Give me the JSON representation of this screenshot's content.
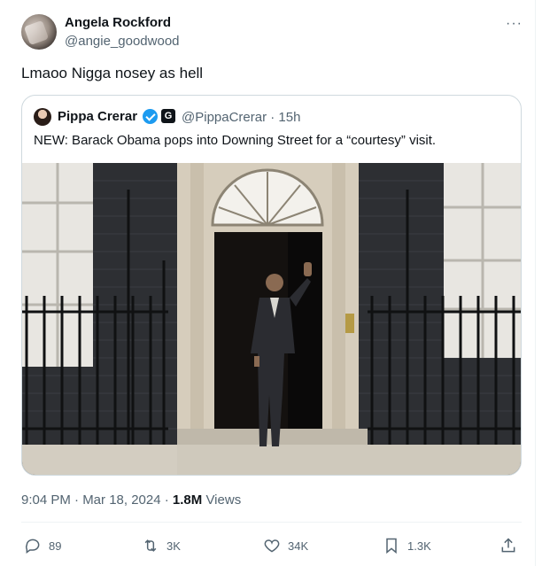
{
  "post": {
    "author_name": "Angela Rockford",
    "author_handle": "@angie_goodwood",
    "more_label": "···",
    "text": "Lmaoo Nigga nosey as hell"
  },
  "quote": {
    "author_name": "Pippa Crerar",
    "author_handle": "@PippaCrerar · 15h",
    "org_badge": "G",
    "text": "NEW: Barack Obama pops into Downing Street for a “courtesy” visit."
  },
  "meta": {
    "time_date": "9:04 PM · Mar 18, 2024 · ",
    "views_count": "1.8M",
    "views_label": " Views"
  },
  "actions": {
    "replies": "89",
    "reposts": "3K",
    "likes": "34K",
    "bookmarks": "1.3K"
  },
  "icons": {
    "more": "more-icon",
    "verified": "verified-icon",
    "reply": "reply-icon",
    "repost": "repost-icon",
    "like": "heart-icon",
    "bookmark": "bookmark-icon",
    "share": "share-icon"
  },
  "colors": {
    "accent": "#1d9bf0",
    "text": "#0f1419",
    "muted": "#536471",
    "border": "#cfd9de"
  }
}
